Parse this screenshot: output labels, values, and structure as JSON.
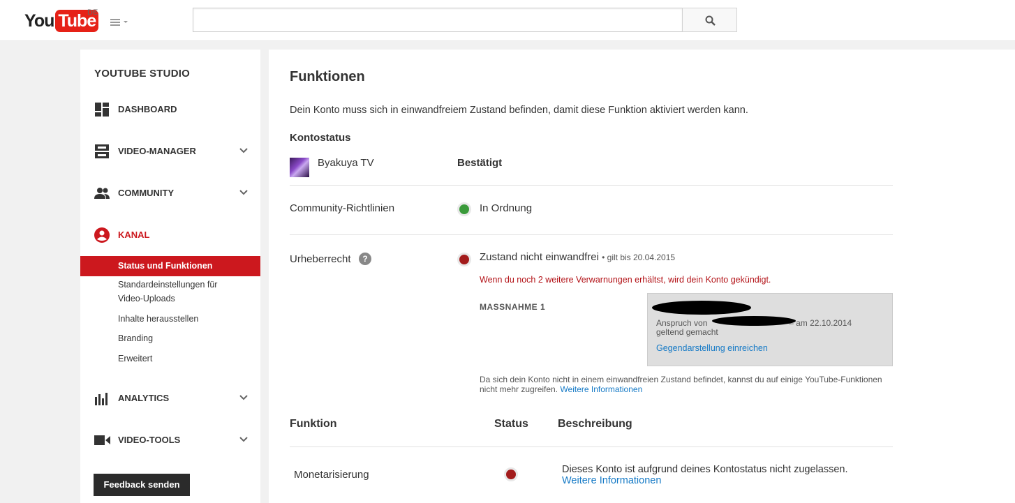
{
  "header": {
    "logo_you": "You",
    "logo_tube": "Tube",
    "country": "DE",
    "search_value": "",
    "search_placeholder": ""
  },
  "sidebar": {
    "title": "YOUTUBE STUDIO",
    "nav": {
      "dashboard": "DASHBOARD",
      "video_manager": "VIDEO-MANAGER",
      "community": "COMMUNITY",
      "kanal": "KANAL",
      "analytics": "ANALYTICS",
      "video_tools": "VIDEO-TOOLS"
    },
    "kanal_items": {
      "status": "Status und Funktionen",
      "upload_defaults": "Standardeinstellungen für Video-Uploads",
      "featured": "Inhalte herausstellen",
      "branding": "Branding",
      "advanced": "Erweitert"
    },
    "feedback": "Feedback senden"
  },
  "main": {
    "title": "Funktionen",
    "description": "Dein Konto muss sich in einwandfreiem Zustand befinden, damit diese Funktion aktiviert werden kann.",
    "kontostatus": "Kontostatus",
    "channel_name": "Byakuya TV",
    "channel_status": "Bestätigt",
    "community_label": "Community-Richtlinien",
    "community_status": "In Ordnung",
    "copyright_label": "Urheberrecht",
    "copyright_help": "?",
    "copyright_status": "Zustand nicht einwandfrei",
    "copyright_valid": "• gilt bis 20.04.2015",
    "warning": "Wenn du noch 2 weitere Verwarnungen erhältst, wird dein Konto gekündigt.",
    "massnahme": "MASSNAHME 1",
    "claim_prefix": "Anspruch von",
    "claim_suffix": "– am 22.10.2014",
    "claim_line2": "geltend gemacht",
    "counter_notice": "Gegendarstellung einreichen",
    "note_text": "Da sich dein Konto nicht in einem einwandfreien Zustand befindet, kannst du auf einige YouTube-Funktionen nicht mehr zugreifen.",
    "note_link": "Weitere Informationen",
    "table": {
      "col_function": "Funktion",
      "col_status": "Status",
      "col_description": "Beschreibung",
      "rows": [
        {
          "function": "Monetarisierung",
          "description": "Dieses Konto ist aufgrund deines Kontostatus nicht zugelassen.",
          "link": "Weitere Informationen"
        }
      ]
    }
  },
  "colors": {
    "brand_red": "#cc181e",
    "status_green": "#3a9a3a",
    "status_red": "#a31c1c",
    "link_blue": "#167ac6"
  },
  "icons": {
    "search": "search-icon",
    "guide": "menu-icon",
    "dashboard": "dashboard-icon",
    "video_manager": "video-manager-icon",
    "community": "community-icon",
    "kanal": "account-icon",
    "analytics": "analytics-icon",
    "video_tools": "video-camera-icon",
    "chevron": "chevron-down-icon"
  }
}
